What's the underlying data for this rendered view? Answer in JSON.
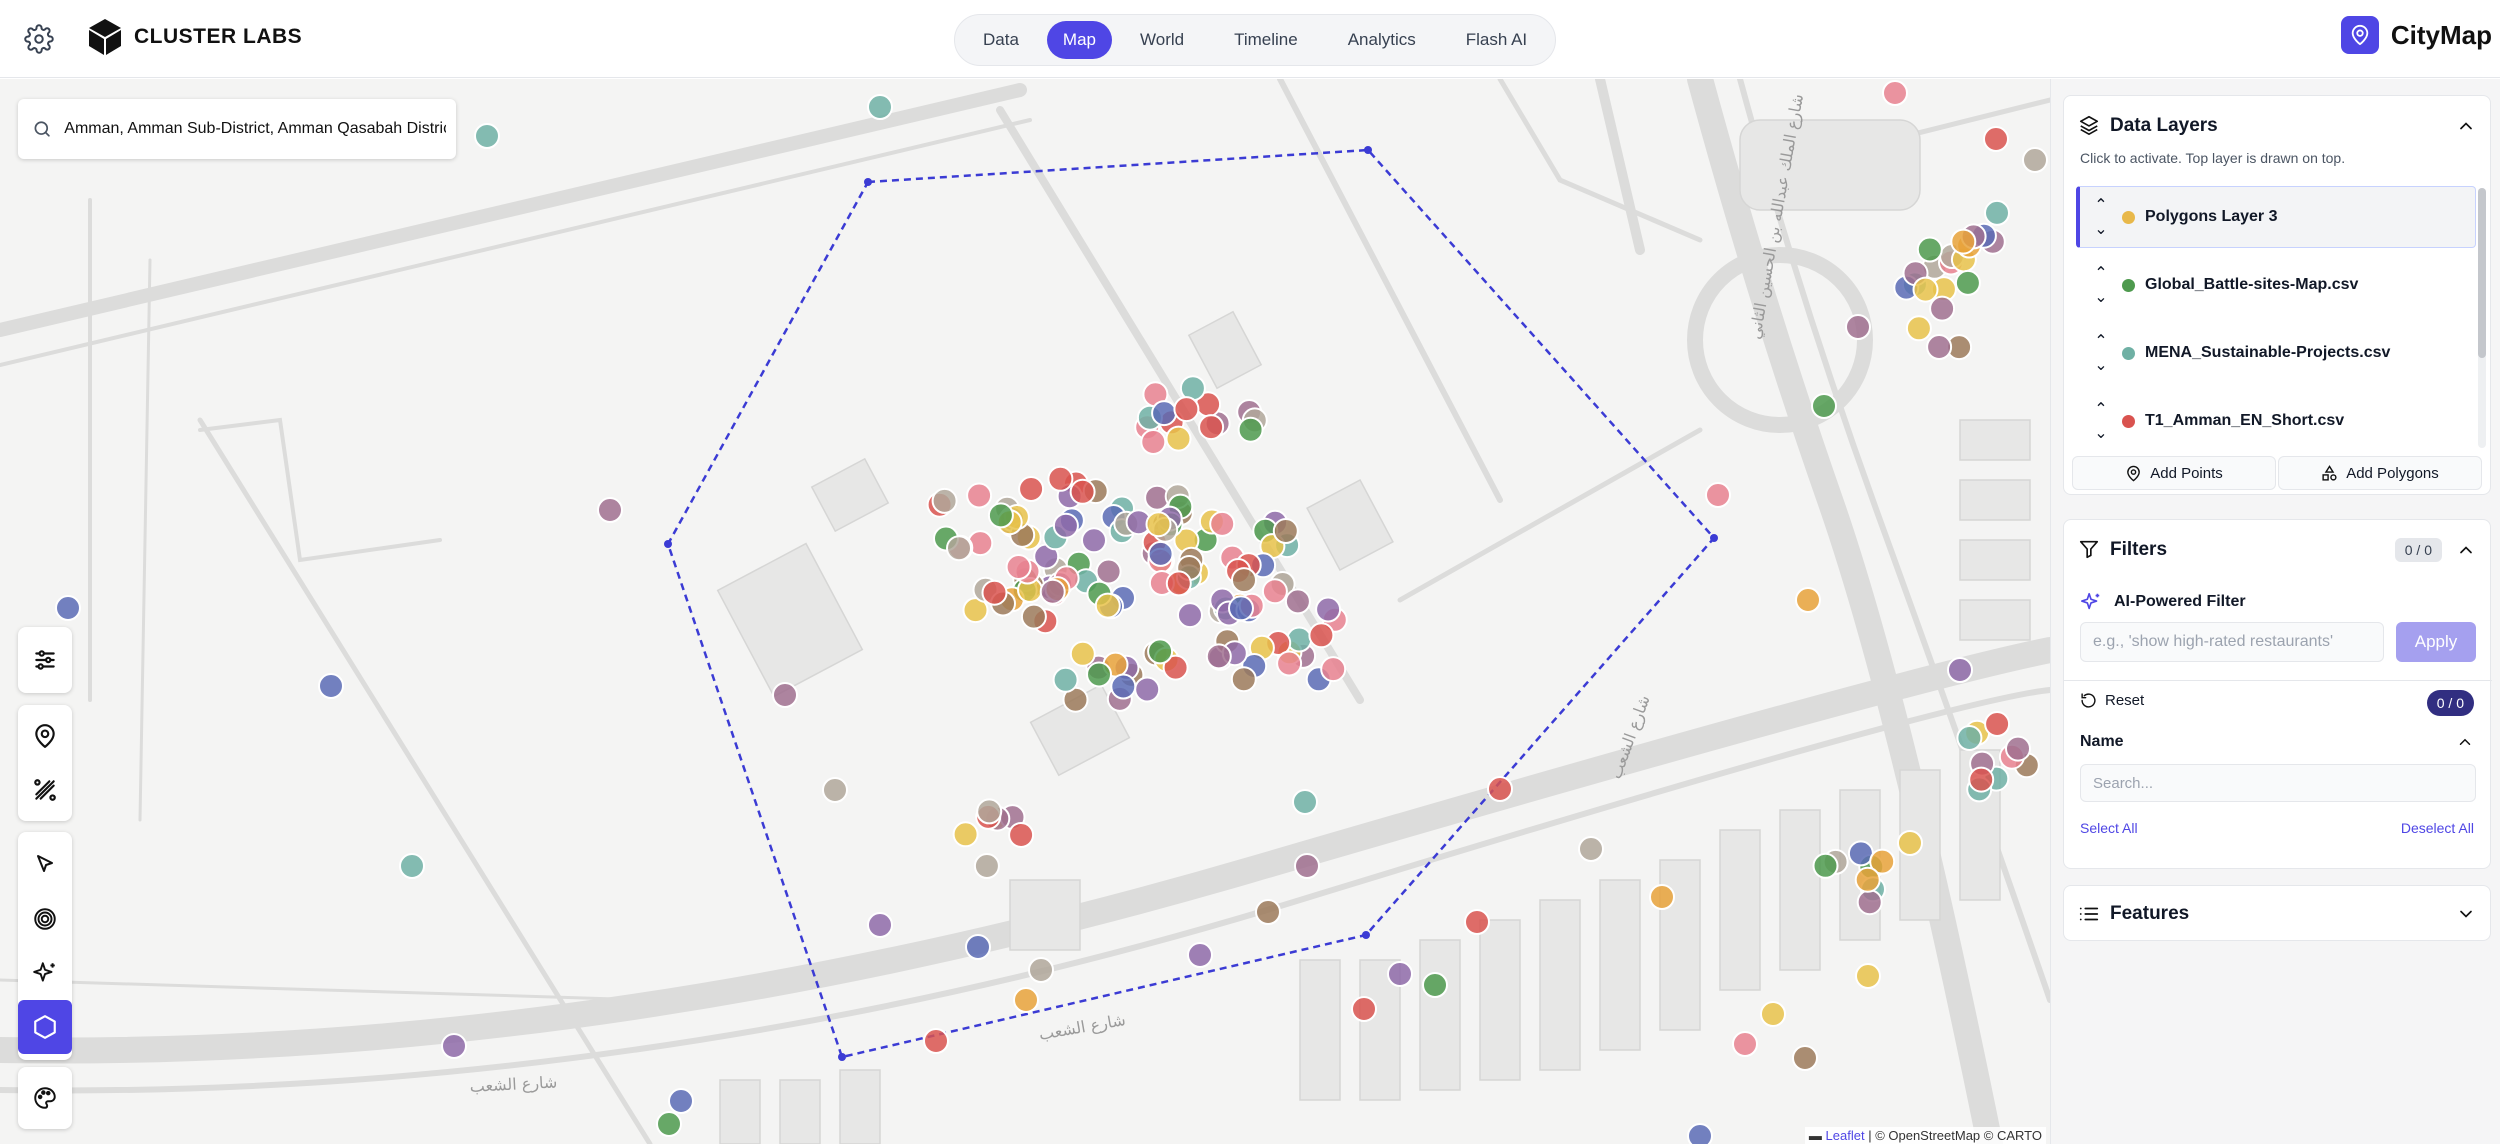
{
  "header": {
    "logo_text": "CLUSTER LABS",
    "tabs": [
      {
        "label": "Data",
        "active": false
      },
      {
        "label": "Map",
        "active": true
      },
      {
        "label": "World",
        "active": false
      },
      {
        "label": "Timeline",
        "active": false
      },
      {
        "label": "Analytics",
        "active": false
      },
      {
        "label": "Flash AI",
        "active": false
      }
    ],
    "brand": "CityMap"
  },
  "map": {
    "search_value": "Amman, Amman Sub-District, Amman Qasabah District",
    "attribution": {
      "leaflet": "Leaflet",
      "rest": " | © OpenStreetMap © CARTO"
    },
    "street_labels": [
      "شارع الشعب",
      "شارع الشعب",
      "شارع الشعب",
      "شارع الملك عبدالله بن الحسين الثاني"
    ],
    "toolbar_icons": [
      "sliders-icon",
      "map-pin-icon",
      "draw-polygon-icon",
      "cursor-arrow-icon",
      "target-icon",
      "ai-sparkle-icon",
      "hexagon-icon",
      "palette-icon"
    ]
  },
  "layers": {
    "title": "Data Layers",
    "hint": "Click to activate. Top layer is drawn on top.",
    "items": [
      {
        "name": "Polygons Layer 3",
        "color": "#e8b84a",
        "active": true
      },
      {
        "name": "Global_Battle-sites-Map.csv",
        "color": "#4e9a4e",
        "active": false
      },
      {
        "name": "MENA_Sustainable-Projects.csv",
        "color": "#6fb0a4",
        "active": false
      },
      {
        "name": "T1_Amman_EN_Short.csv",
        "color": "#d9534f",
        "active": false
      }
    ],
    "add_points": "Add Points",
    "add_polygons": "Add Polygons"
  },
  "filters": {
    "title": "Filters",
    "count": "0 / 0",
    "ai_label": "AI-Powered Filter",
    "ai_placeholder": "e.g., 'show high-rated restaurants'",
    "apply": "Apply",
    "reset": "Reset",
    "reset_count": "0 / 0",
    "name_label": "Name",
    "name_placeholder": "Search...",
    "select_all": "Select All",
    "deselect_all": "Deselect All"
  },
  "features": {
    "title": "Features"
  },
  "colors": {
    "accent": "#4f46e5",
    "polygon_stroke": "#3b3bd4",
    "point_palette": [
      "#d9534f",
      "#e8a23a",
      "#e8c24a",
      "#4e9a4e",
      "#6fb0a4",
      "#5b6bb5",
      "#a0708f",
      "#9c7a5b",
      "#e8818f",
      "#b0a79a",
      "#8e6aa8"
    ]
  }
}
